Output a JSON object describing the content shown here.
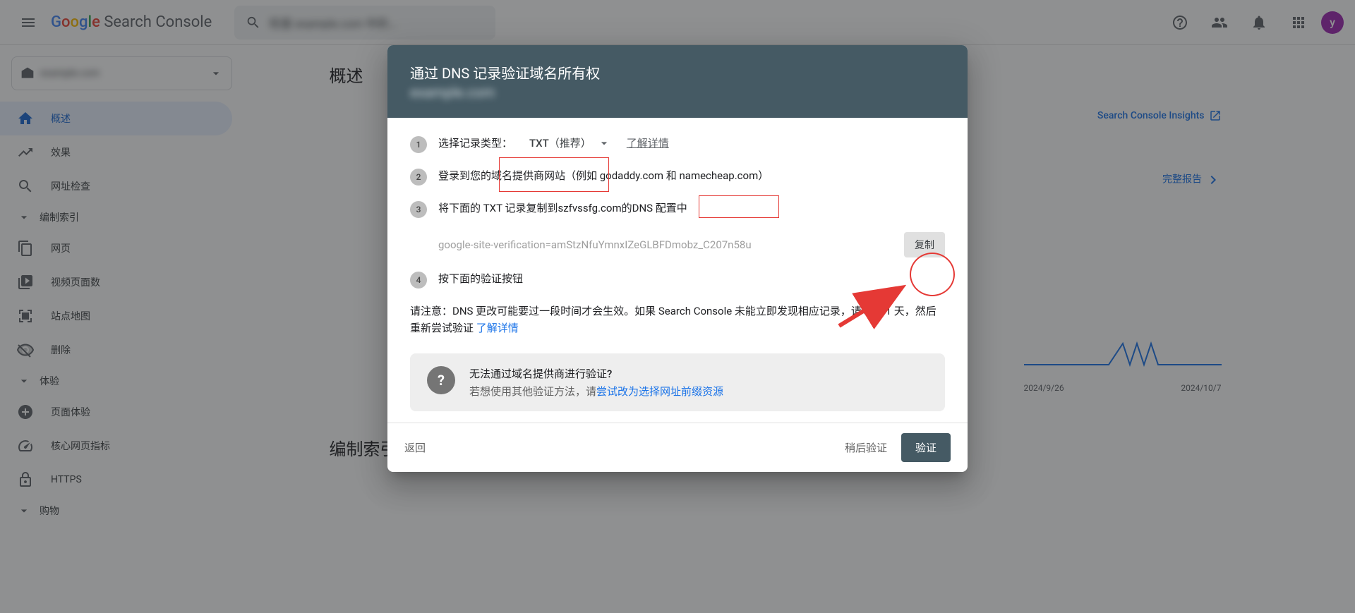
{
  "header": {
    "logo_text": "Search Console",
    "search_placeholder": "检查 example.com 中的...",
    "avatar_letter": "y"
  },
  "sidebar": {
    "property_label": "example.com",
    "items": [
      {
        "label": "概述",
        "icon": "home-icon",
        "active": true
      },
      {
        "label": "效果",
        "icon": "trending-icon",
        "active": false
      },
      {
        "label": "网址检查",
        "icon": "search-icon",
        "active": false
      }
    ],
    "sections": [
      {
        "title": "编制索引",
        "items": [
          {
            "label": "网页",
            "icon": "pages-icon"
          },
          {
            "label": "视频页面数",
            "icon": "video-icon"
          },
          {
            "label": "站点地图",
            "icon": "sitemap-icon"
          },
          {
            "label": "删除",
            "icon": "remove-icon"
          }
        ]
      },
      {
        "title": "体验",
        "items": [
          {
            "label": "页面体验",
            "icon": "plus-circle-icon"
          },
          {
            "label": "核心网页指标",
            "icon": "speed-icon"
          },
          {
            "label": "HTTPS",
            "icon": "lock-icon"
          }
        ]
      },
      {
        "title": "购物",
        "items": []
      }
    ]
  },
  "main": {
    "page_title": "概述",
    "insights_link": "Search Console Insights",
    "full_report": "完整报告",
    "section2_title": "编制索引",
    "chart_dates": [
      "2024/9/26",
      "2024/10/7"
    ]
  },
  "dialog": {
    "title": "通过 DNS 记录验证域名所有权",
    "subtitle": "example.com",
    "step1_label": "选择记录类型：",
    "step1_value": "TXT（推荐）",
    "step1_link": "了解详情",
    "step2_text": "登录到您的域名提供商网站（例如 godaddy.com 和 namecheap.com）",
    "step3_prefix": "将下面的 TXT 记录复制到 ",
    "step3_domain": "szfvssfg.com",
    "step3_mid": " 的 ",
    "step3_suffix": "DNS 配置中",
    "txt_value": "google-site-verification=amStzNfuYmnxIZeGLBFDmobz_C207n58u",
    "copy_btn": "复制",
    "step4_text": "按下面的验证按钮",
    "note_text": "请注意：DNS 更改可能要过一段时间才会生效。如果 Search Console 未能立即发现相应记录，请等待 1 天，然后重新尝试验证 ",
    "note_link": "了解详情",
    "info_title": "无法通过域名提供商进行验证?",
    "info_desc_prefix": "若想使用其他验证方法，请",
    "info_desc_link": "尝试改为选择网址前缀资源",
    "footer_back": "返回",
    "footer_later": "稍后验证",
    "footer_verify": "验证"
  }
}
